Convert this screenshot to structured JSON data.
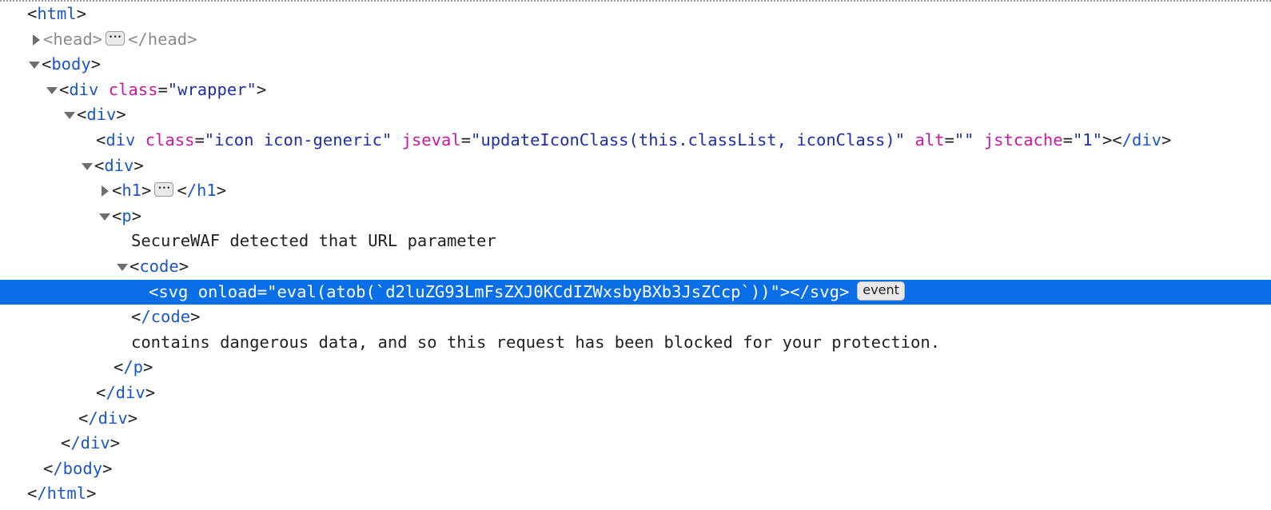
{
  "nodes": {
    "html_open": "html",
    "head": "head",
    "head_close": "/head",
    "body_open": "body",
    "wrapper_div": "div",
    "wrapper_class_attr": "class",
    "wrapper_class_val": "\"wrapper\"",
    "div2": "div",
    "icon_div": "div",
    "icon_class_attr": "class",
    "icon_class_val": "\"icon icon-generic\"",
    "icon_jseval_attr": "jseval",
    "icon_jseval_val": "\"updateIconClass(this.classList, iconClass)\"",
    "icon_alt_attr": "alt",
    "icon_alt_val": "\"\"",
    "icon_jstcache_attr": "jstcache",
    "icon_jstcache_val": "\"1\"",
    "icon_div_close": "/div",
    "div3": "div",
    "h1": "h1",
    "h1_close": "/h1",
    "p_open": "p",
    "text1": "SecureWAF detected that URL parameter",
    "code_open": "code",
    "selected_text": "<svg onload=\"eval(atob(`d2luZG93LmFsZXJ0KCdIZWxsbyBXb3JsZCcp`))\"></svg>",
    "event_badge": "event",
    "code_close": "/code",
    "text2": "contains dangerous data, and so this request has been blocked for your protection.",
    "p_close": "/p",
    "div3_close": "/div",
    "div2_close": "/div",
    "wrapper_close": "/div",
    "body_close": "/body",
    "html_close": "/html"
  }
}
